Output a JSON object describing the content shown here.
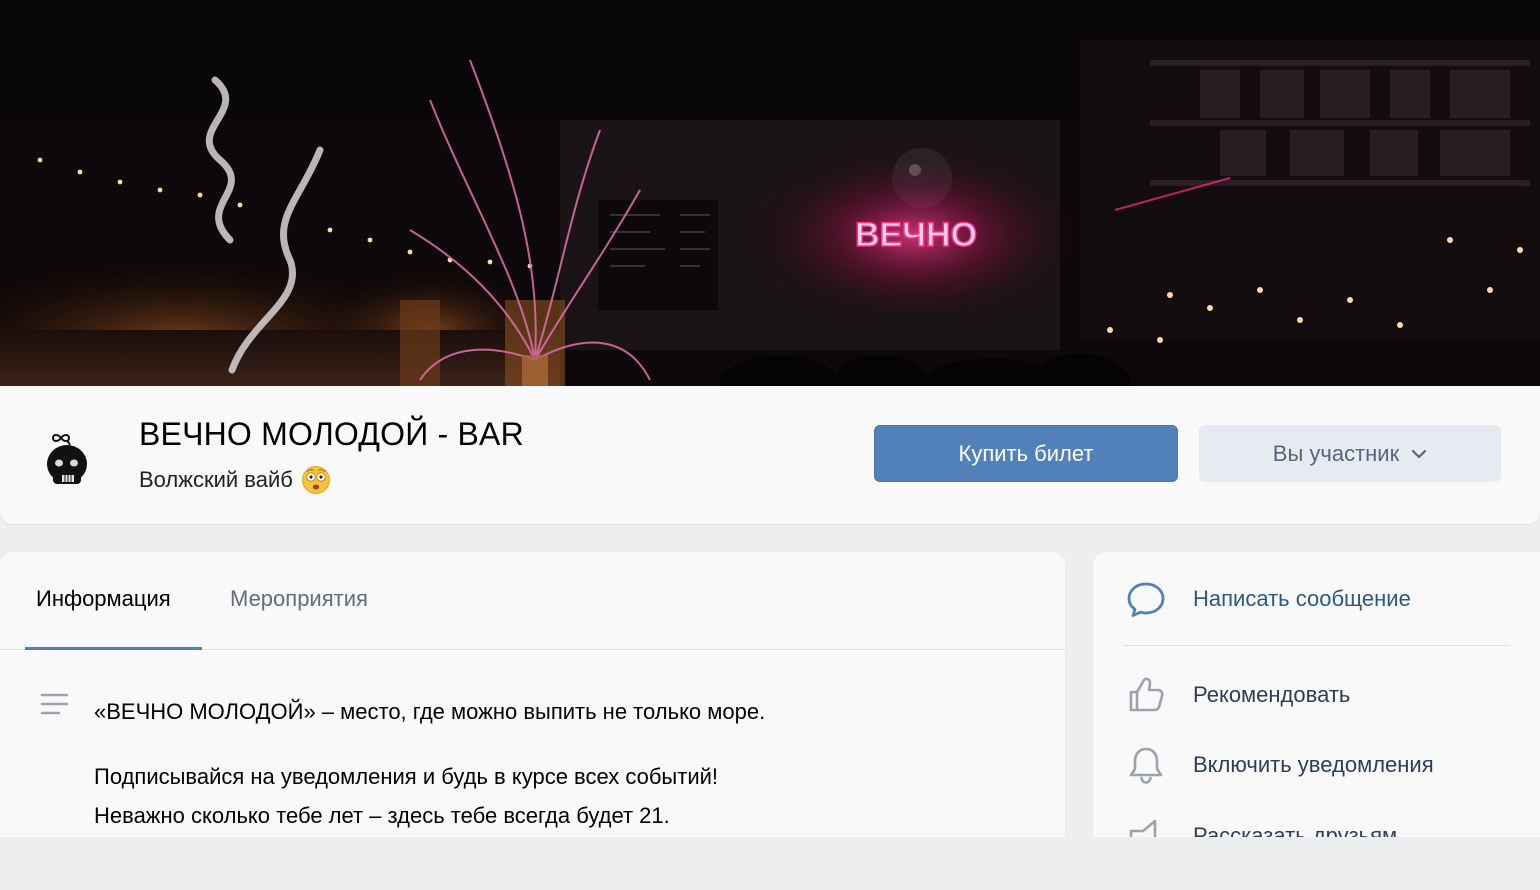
{
  "group": {
    "name": "ВЕЧНО МОЛОДОЙ - BAR",
    "status": "Волжский вайб",
    "status_emoji": "astonished-face-emoji"
  },
  "cover": {
    "neon_sign": "ВЕЧНО"
  },
  "buttons": {
    "buy_ticket": "Купить билет",
    "member": "Вы участник"
  },
  "tabs": [
    {
      "label": "Информация",
      "active": true
    },
    {
      "label": "Мероприятия",
      "active": false
    }
  ],
  "description": {
    "line1": "«ВЕЧНО МОЛОДОЙ» – место, где можно выпить не только море.",
    "line2": "Подписывайся на уведомления и будь в курсе всех событий!",
    "line3": "Неважно сколько тебе лет – здесь тебе всегда будет 21."
  },
  "actions": {
    "message": {
      "label": "Написать сообщение",
      "icon": "chat-bubble-icon"
    },
    "recommend": {
      "label": "Рекомендовать",
      "icon": "thumbs-up-icon"
    },
    "notifications": {
      "label": "Включить уведомления",
      "icon": "bell-icon"
    },
    "share": {
      "label": "Рассказать друзьям",
      "icon": "megaphone-icon"
    }
  },
  "colors": {
    "accent": "#5181b8",
    "link": "#2a5885",
    "secondary_button_bg": "#e5ebf1",
    "secondary_button_text": "#55677d",
    "neon_pink": "#ff2d8a",
    "background": "#edeef0"
  }
}
